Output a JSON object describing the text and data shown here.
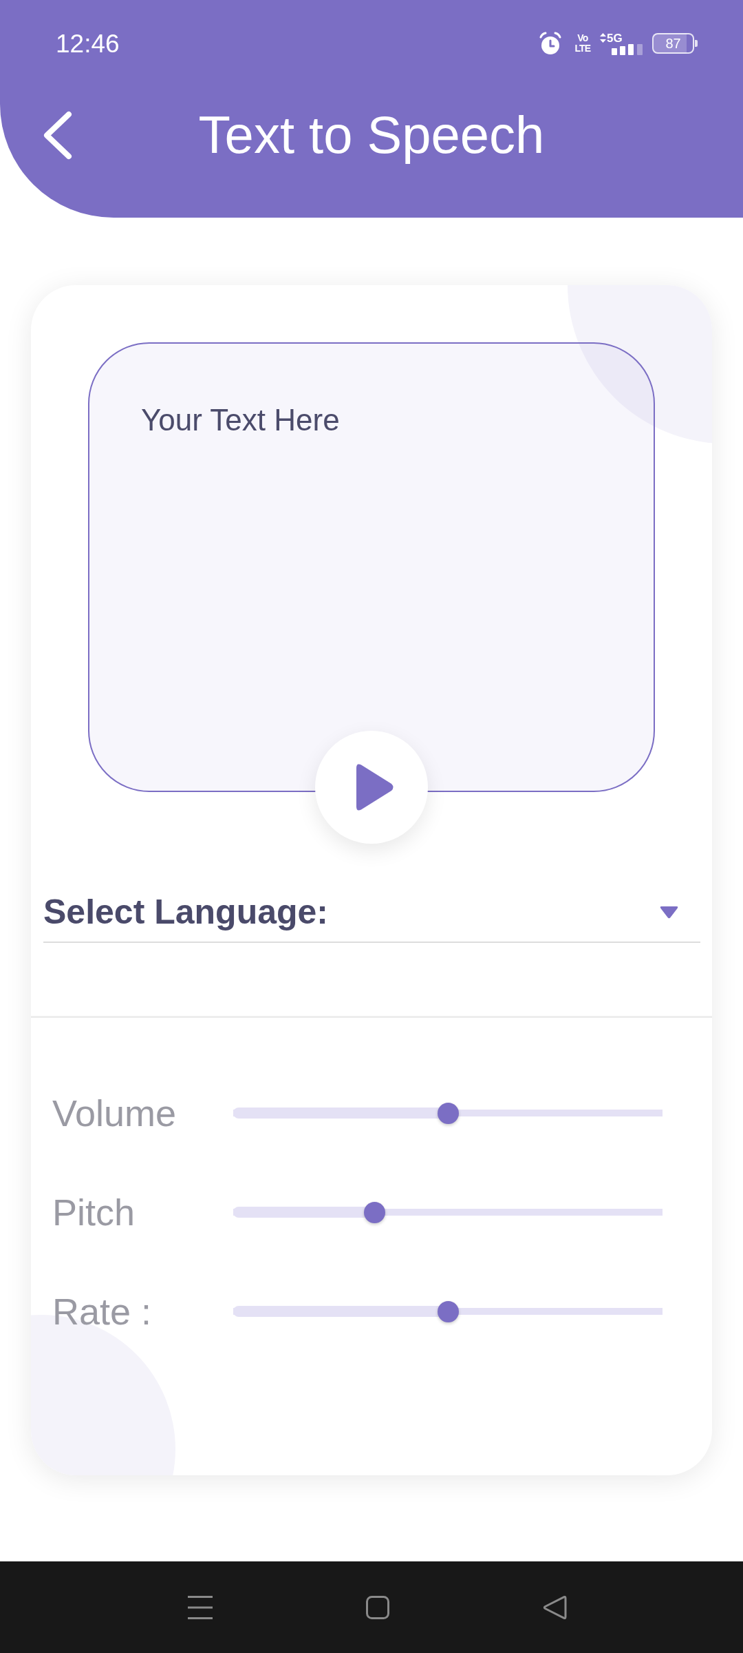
{
  "status_bar": {
    "time": "12:46",
    "volte": [
      "Vo",
      "LTE"
    ],
    "network": "5G",
    "battery": "87"
  },
  "header": {
    "title": "Text to Speech"
  },
  "text_input": {
    "placeholder": "Your Text Here"
  },
  "language_select": {
    "label": "Select Language:"
  },
  "sliders": [
    {
      "label": "Volume",
      "level": 0.5
    },
    {
      "label": "Pitch",
      "level": 0.33
    },
    {
      "label": "Rate :",
      "level": 0.5
    }
  ]
}
